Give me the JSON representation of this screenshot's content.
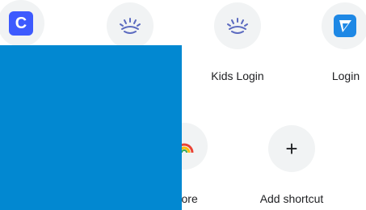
{
  "shortcuts": {
    "row1": [
      {
        "label": "",
        "icon": "c-app-icon"
      },
      {
        "label": "",
        "icon": "sunrise-eye-icon"
      },
      {
        "label": "Kids Login",
        "icon": "sunrise-eye-icon"
      },
      {
        "label": "Login",
        "icon": "blue-triangle-app-icon"
      }
    ],
    "row2": [
      {
        "label": "Store",
        "icon": "rainbow-icon"
      },
      {
        "label": "Add shortcut",
        "icon": "plus-icon"
      }
    ]
  },
  "colors": {
    "overlay": "#0288d1",
    "c_icon": "#3d5afe",
    "login_icon": "#1e88e5",
    "tile_bg": "#f1f3f4"
  },
  "glyphs": {
    "c_letter": "C",
    "plus": "+"
  }
}
